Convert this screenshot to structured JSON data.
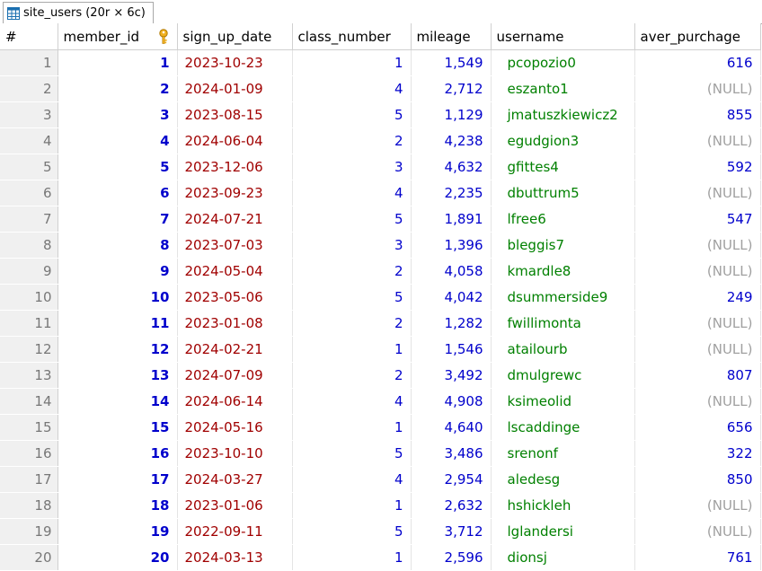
{
  "tab": {
    "label": "site_users (20r × 6c)"
  },
  "columns": [
    "#",
    "member_id",
    "sign_up_date",
    "class_number",
    "mileage",
    "username",
    "aver_purchage"
  ],
  "null_label": "(NULL)",
  "rows": [
    [
      "1",
      "1",
      "2023-10-23",
      "1",
      "1,549",
      "pcopozio0",
      "616"
    ],
    [
      "2",
      "2",
      "2024-01-09",
      "4",
      "2,712",
      "eszanto1",
      "(NULL)"
    ],
    [
      "3",
      "3",
      "2023-08-15",
      "5",
      "1,129",
      "jmatuszkiewicz2",
      "855"
    ],
    [
      "4",
      "4",
      "2024-06-04",
      "2",
      "4,238",
      "egudgion3",
      "(NULL)"
    ],
    [
      "5",
      "5",
      "2023-12-06",
      "3",
      "4,632",
      "gfittes4",
      "592"
    ],
    [
      "6",
      "6",
      "2023-09-23",
      "4",
      "2,235",
      "dbuttrum5",
      "(NULL)"
    ],
    [
      "7",
      "7",
      "2024-07-21",
      "5",
      "1,891",
      "lfree6",
      "547"
    ],
    [
      "8",
      "8",
      "2023-07-03",
      "3",
      "1,396",
      "bleggis7",
      "(NULL)"
    ],
    [
      "9",
      "9",
      "2024-05-04",
      "2",
      "4,058",
      "kmardle8",
      "(NULL)"
    ],
    [
      "10",
      "10",
      "2023-05-06",
      "5",
      "4,042",
      "dsummerside9",
      "249"
    ],
    [
      "11",
      "11",
      "2023-01-08",
      "2",
      "1,282",
      "fwillimonta",
      "(NULL)"
    ],
    [
      "12",
      "12",
      "2024-02-21",
      "1",
      "1,546",
      "atailourb",
      "(NULL)"
    ],
    [
      "13",
      "13",
      "2024-07-09",
      "2",
      "3,492",
      "dmulgrewc",
      "807"
    ],
    [
      "14",
      "14",
      "2024-06-14",
      "4",
      "4,908",
      "ksimeolid",
      "(NULL)"
    ],
    [
      "15",
      "15",
      "2024-05-16",
      "1",
      "4,640",
      "lscaddinge",
      "656"
    ],
    [
      "16",
      "16",
      "2023-10-10",
      "5",
      "3,486",
      "srenonf",
      "322"
    ],
    [
      "17",
      "17",
      "2024-03-27",
      "4",
      "2,954",
      "aledesg",
      "850"
    ],
    [
      "18",
      "18",
      "2023-01-06",
      "1",
      "2,632",
      "hshickleh",
      "(NULL)"
    ],
    [
      "19",
      "19",
      "2022-09-11",
      "5",
      "3,712",
      "lglandersi",
      "(NULL)"
    ],
    [
      "20",
      "20",
      "2024-03-13",
      "1",
      "2,596",
      "dionsj",
      "761"
    ]
  ]
}
